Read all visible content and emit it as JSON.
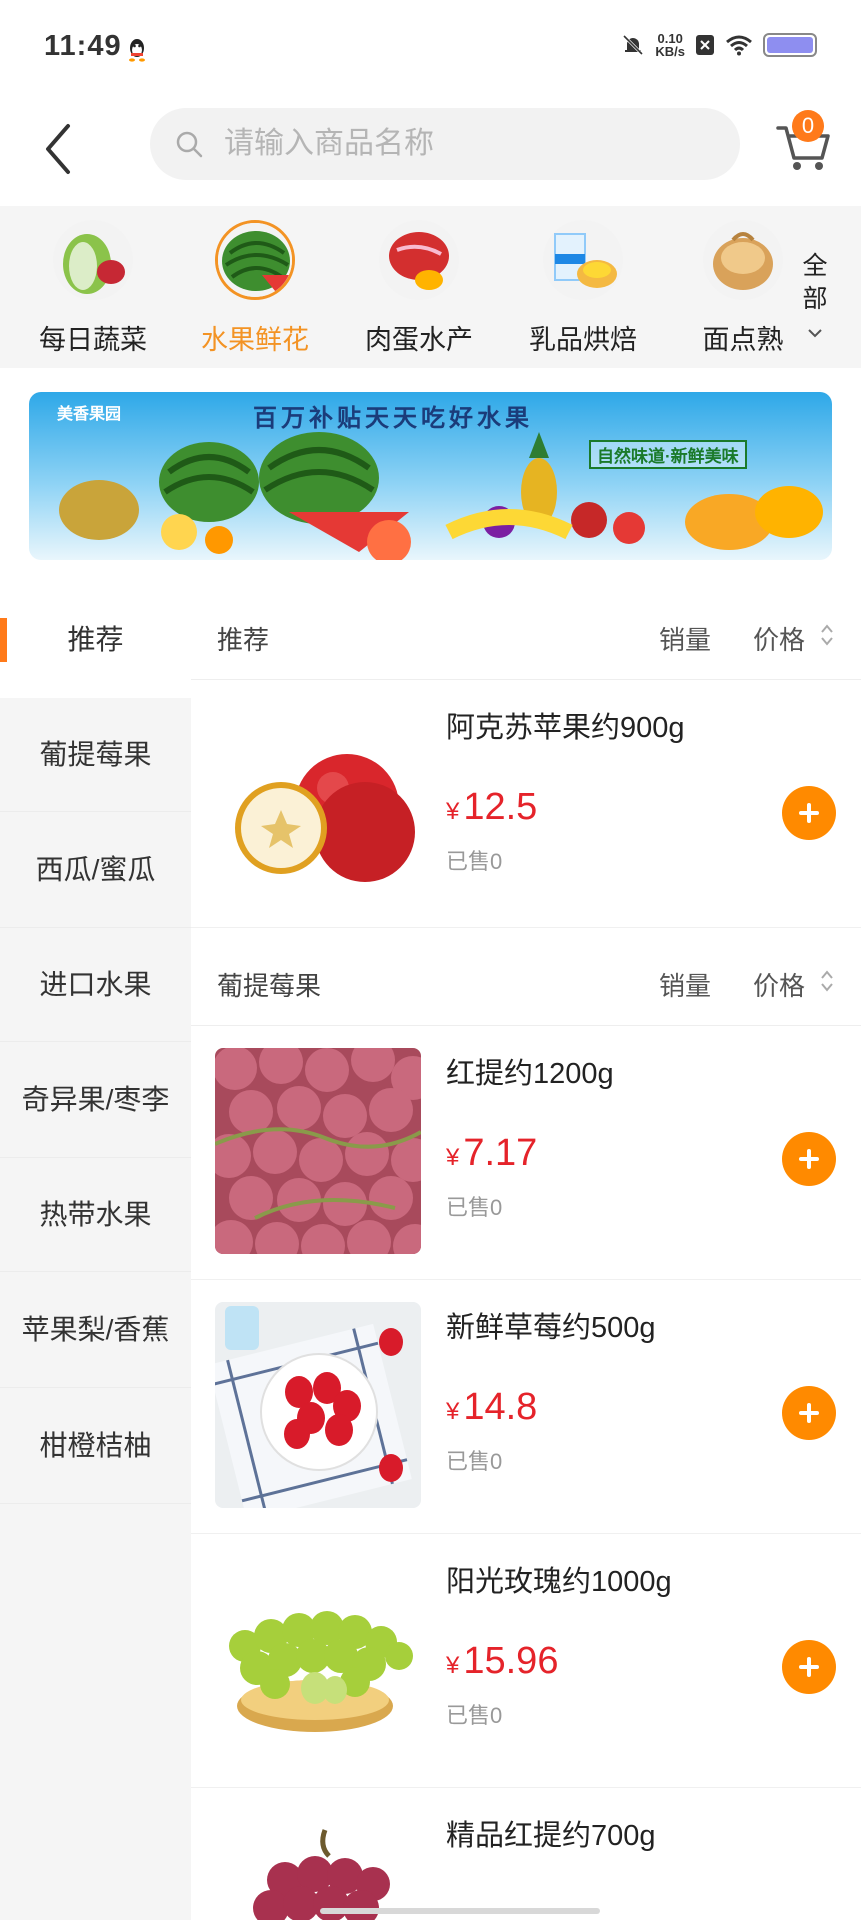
{
  "status_bar": {
    "time": "11:49",
    "net_speed_value": "0.10",
    "net_speed_unit": "KB/s"
  },
  "search": {
    "placeholder": "请输入商品名称"
  },
  "cart": {
    "count": "0"
  },
  "categories": [
    {
      "label": "每日蔬菜",
      "active": false
    },
    {
      "label": "水果鲜花",
      "active": true
    },
    {
      "label": "肉蛋水产",
      "active": false
    },
    {
      "label": "乳品烘焙",
      "active": false
    },
    {
      "label": "面点熟",
      "active": false
    }
  ],
  "category_all": {
    "line1": "全",
    "line2": "部"
  },
  "banner": {
    "brand": "美香果园",
    "title": "百万补贴天天吃好水果",
    "slogan": "自然味道·新鲜美味"
  },
  "sidebar": {
    "items": [
      {
        "label": "推荐",
        "active": true
      },
      {
        "label": "葡提莓果",
        "active": false
      },
      {
        "label": "西瓜/蜜瓜",
        "active": false
      },
      {
        "label": "进口水果",
        "active": false
      },
      {
        "label": "奇异果/枣李",
        "active": false
      },
      {
        "label": "热带水果",
        "active": false
      },
      {
        "label": "苹果梨/香蕉",
        "active": false
      },
      {
        "label": "柑橙桔柚",
        "active": false
      }
    ]
  },
  "sort": {
    "sales": "销量",
    "price": "价格"
  },
  "sections": [
    {
      "title": "推荐",
      "products": [
        {
          "name": "阿克苏苹果约900g",
          "currency": "¥",
          "price": "12.5",
          "sold": "已售0",
          "image": "apple"
        }
      ]
    },
    {
      "title": "葡提莓果",
      "products": [
        {
          "name": "红提约1200g",
          "currency": "¥",
          "price": "7.17",
          "sold": "已售0",
          "image": "red-grape"
        },
        {
          "name": "新鲜草莓约500g",
          "currency": "¥",
          "price": "14.8",
          "sold": "已售0",
          "image": "strawberry"
        },
        {
          "name": "阳光玫瑰约1000g",
          "currency": "¥",
          "price": "15.96",
          "sold": "已售0",
          "image": "green-grape"
        },
        {
          "name": "精品红提约700g",
          "currency": "¥",
          "price": "",
          "sold": "",
          "image": "red-grape"
        }
      ]
    }
  ],
  "colors": {
    "accent": "#ff8a00",
    "active_text": "#f39324",
    "price": "#e5232a",
    "badge": "#ff7a1a"
  }
}
